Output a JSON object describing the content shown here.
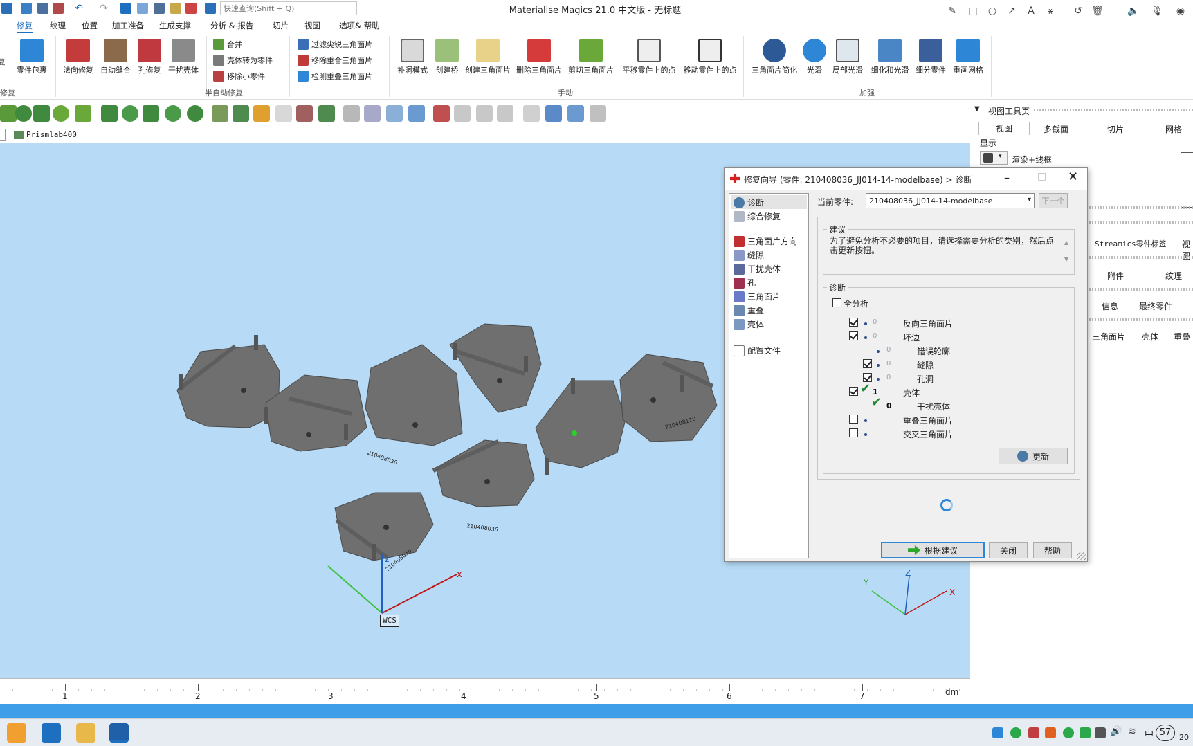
{
  "titlebar": {
    "title": "Materialise Magics 21.0 中文版 - 无标题",
    "search_placeholder": "快速查询(Shift + Q)"
  },
  "tabs": [
    "修复",
    "纹理",
    "位置",
    "加工准备",
    "生成支撑",
    "分析 & 报告",
    "切片",
    "视图",
    "选项& 帮助"
  ],
  "ribbon": {
    "big1": [
      "零件包裹",
      "法向修复",
      "自动缝合",
      "孔修复",
      "干扰壳体"
    ],
    "small_left": [
      "合并",
      "壳体转为零件",
      "移除小零件"
    ],
    "small_right": [
      "过滤尖锐三角面片",
      "移除重合三角面片",
      "检测重叠三角面片"
    ],
    "manual": [
      "补洞模式",
      "创建桥",
      "创建三角面片",
      "删除三角面片",
      "剪切三角面片",
      "平移零件上的点",
      "移动零件上的点"
    ],
    "enhance": [
      "三角面片简化",
      "光滑",
      "局部光滑",
      "细化和光滑",
      "细分零件",
      "重画网格"
    ],
    "groups": {
      "repair": "修复",
      "semi_auto": "半自动修复",
      "manual": "手动",
      "enhance": "加强"
    },
    "left_cut": "复"
  },
  "part_tab": "Prismlab400",
  "viewport": {
    "wcs": "WCS",
    "axis_x": "x",
    "axis_z": "z",
    "mini_x": "X",
    "mini_y": "Y",
    "mini_z": "Z",
    "labels": [
      "210408036",
      "210408036",
      "210408036",
      "210408110"
    ]
  },
  "ruler": {
    "ticks": [
      "1",
      "2",
      "3",
      "4",
      "5",
      "6",
      "7"
    ],
    "unit": "dm"
  },
  "right_panel": {
    "header": "视图工具页",
    "tabs": [
      "视图",
      "多截面",
      "切片",
      "网格"
    ],
    "display": "显示",
    "render_mode": "渲染+线框",
    "streamics": "Streamics零件标签",
    "view_cut": "视图",
    "row2": [
      "附件",
      "纹理"
    ],
    "row3": [
      "信息",
      "最终零件"
    ],
    "row4": [
      "三角面片",
      "壳体",
      "重叠"
    ]
  },
  "dialog": {
    "title": "修复向导 (零件: 210408036_JJ014-14-modelbase) > 诊断",
    "current_part_label": "当前零件:",
    "current_part_value": "210408036_JJ014-14-modelbase",
    "next_button": "下一个",
    "nav_items": [
      "诊断",
      "综合修复",
      "三角面片方向",
      "缝隙",
      "干扰壳体",
      "孔",
      "三角面片",
      "重叠",
      "壳体",
      "配置文件"
    ],
    "suggestion_legend": "建议",
    "suggestion_text": "为了避免分析不必要的项目，请选择需要分析的类别，然后点击更新按钮。",
    "diagnosis_legend": "诊断",
    "full_analysis": "全分析",
    "rows": [
      {
        "checked": true,
        "count": "0",
        "label": "反向三角面片",
        "ok": false
      },
      {
        "checked": true,
        "count": "0",
        "label": "坏边",
        "ok": false
      },
      {
        "checked": null,
        "count": "0",
        "label": "错误轮廓",
        "ok": false
      },
      {
        "checked": true,
        "count": "0",
        "label": "缝隙",
        "ok": false
      },
      {
        "checked": true,
        "count": "0",
        "label": "孔洞",
        "ok": false
      },
      {
        "checked": true,
        "count": "1",
        "label": "壳体",
        "ok": true
      },
      {
        "checked": null,
        "count": "0",
        "label": "干扰壳体",
        "ok": true
      },
      {
        "checked": false,
        "count": "",
        "label": "重叠三角面片",
        "ok": false
      },
      {
        "checked": false,
        "count": "",
        "label": "交叉三角面片",
        "ok": false
      }
    ],
    "update_button": "更新",
    "apply_button": "根据建议",
    "close_button": "关闭",
    "help_button": "帮助"
  },
  "taskbar": {
    "tray_text": "中",
    "badge": "57",
    "clock_cut": "20"
  },
  "colors": {
    "viewport": "#b7dbf6",
    "accent": "#1e6fbf",
    "part_gray": "#6f6f6f"
  }
}
